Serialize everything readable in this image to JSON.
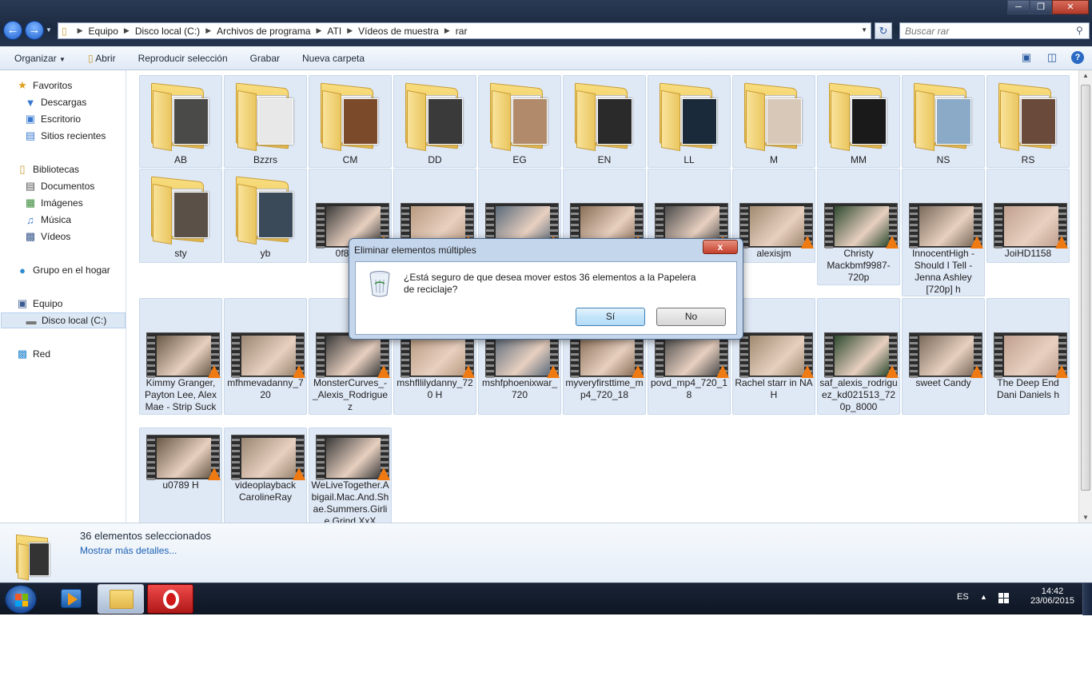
{
  "window": {
    "minimize": "─",
    "maximize": "❒",
    "close": "✕"
  },
  "address": {
    "breadcrumbs": [
      "Equipo",
      "Disco local (C:)",
      "Archivos de programa",
      "ATI",
      "Vídeos de muestra",
      "rar"
    ],
    "search_placeholder": "Buscar rar"
  },
  "toolbar": {
    "organize": "Organizar",
    "open": "Abrir",
    "play": "Reproducir selección",
    "burn": "Grabar",
    "new_folder": "Nueva carpeta"
  },
  "sidebar": {
    "favorites": "Favoritos",
    "downloads": "Descargas",
    "desktop": "Escritorio",
    "recent": "Sitios recientes",
    "libraries": "Bibliotecas",
    "documents": "Documentos",
    "images": "Imágenes",
    "music": "Música",
    "videos": "Vídeos",
    "homegroup": "Grupo en el hogar",
    "computer": "Equipo",
    "localdisk": "Disco local (C:)",
    "network": "Red"
  },
  "items": [
    {
      "label": "AB",
      "kind": "folder"
    },
    {
      "label": "Bzzrs",
      "kind": "folder"
    },
    {
      "label": "CM",
      "kind": "folder"
    },
    {
      "label": "DD",
      "kind": "folder"
    },
    {
      "label": "EG",
      "kind": "folder"
    },
    {
      "label": "EN",
      "kind": "folder"
    },
    {
      "label": "LL",
      "kind": "folder"
    },
    {
      "label": "M",
      "kind": "folder"
    },
    {
      "label": "MM",
      "kind": "folder"
    },
    {
      "label": "NS",
      "kind": "folder"
    },
    {
      "label": "RS",
      "kind": "folder"
    },
    {
      "label": "sty",
      "kind": "folder"
    },
    {
      "label": "yb",
      "kind": "folder"
    },
    {
      "label": "0f8654",
      "kind": "video"
    },
    {
      "label": "",
      "kind": "video"
    },
    {
      "label": "",
      "kind": "video"
    },
    {
      "label": "",
      "kind": "video"
    },
    {
      "label": "",
      "kind": "video"
    },
    {
      "label": "alexisjm",
      "kind": "video"
    },
    {
      "label": "Christy Mackbmf9987-720p",
      "kind": "video"
    },
    {
      "label": "InnocentHigh - Should I Tell - Jenna Ashley [720p] h",
      "kind": "video"
    },
    {
      "label": "JoiHD1158",
      "kind": "video"
    },
    {
      "label": "Kimmy Granger, Payton Lee, Alex Mae - Strip Suck Fuck",
      "kind": "video"
    },
    {
      "label": "mfhmevadanny_720",
      "kind": "video"
    },
    {
      "label": "MonsterCurves_-_Alexis_Rodriguez",
      "kind": "video"
    },
    {
      "label": "mshfllilydanny_720 H",
      "kind": "video"
    },
    {
      "label": "mshfphoenixwar_720",
      "kind": "video"
    },
    {
      "label": "myveryfirsttime_mp4_720_18",
      "kind": "video"
    },
    {
      "label": "povd_mp4_720_18",
      "kind": "video"
    },
    {
      "label": "Rachel starr in NA H",
      "kind": "video"
    },
    {
      "label": "saf_alexis_rodriguez_kd021513_720p_8000",
      "kind": "video"
    },
    {
      "label": "sweet Candy",
      "kind": "video"
    },
    {
      "label": "The Deep End Dani Daniels h",
      "kind": "video"
    },
    {
      "label": "u0789 H",
      "kind": "video"
    },
    {
      "label": "videoplayback CarolineRay",
      "kind": "video"
    },
    {
      "label": "WeLiveTogether.Abigail.Mac.And.Shae.Summers.Girlie Grind XxX",
      "kind": "video"
    }
  ],
  "details": {
    "count": "36 elementos seleccionados",
    "more": "Mostrar más detalles..."
  },
  "dialog": {
    "title": "Eliminar elementos múltiples",
    "message": "¿Está seguro de que desea mover estos 36 elementos a la Papelera de reciclaje?",
    "yes": "Sí",
    "no": "No",
    "close": "x"
  },
  "taskbar": {
    "lang": "ES",
    "time": "14:42",
    "date": "23/06/2015"
  },
  "colors": {
    "accent": "#1a5fb4",
    "vlc_orange": "#f07a12",
    "selection": "#dfe8f5"
  }
}
